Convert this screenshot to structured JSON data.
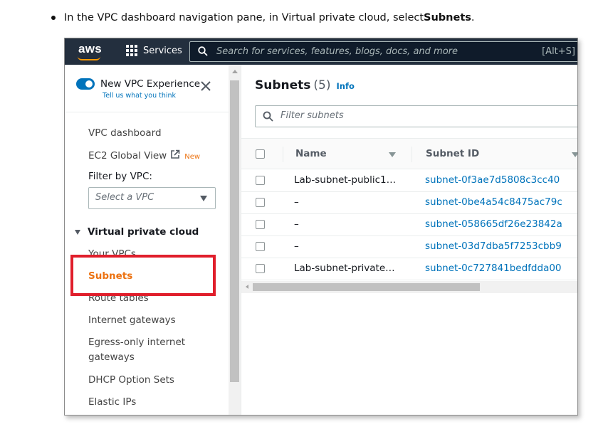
{
  "instruction": {
    "prefix": "In the VPC dashboard navigation pane, in Virtual private cloud, select ",
    "emphasis": "Subnets",
    "suffix": "."
  },
  "topbar": {
    "logo": "aws",
    "services_label": "Services",
    "search_placeholder": "Search for services, features, blogs, docs, and more",
    "search_shortcut": "[Alt+S]"
  },
  "sidebar": {
    "new_experience_label": "New VPC Experience",
    "new_experience_link": "Tell us what you think",
    "toggle_on": true,
    "items": {
      "vpc_dashboard": "VPC dashboard",
      "ec2_global_view": "EC2 Global View",
      "new_badge": "New",
      "filter_by_vpc": "Filter by VPC:",
      "select_vpc_placeholder": "Select a VPC",
      "section_title": "Virtual private cloud",
      "your_vpcs": "Your VPCs",
      "subnets": "Subnets",
      "route_tables": "Route tables",
      "internet_gateways": "Internet gateways",
      "egress_line1": "Egress-only internet",
      "egress_line2": "gateways",
      "dhcp_option_sets": "DHCP Option Sets",
      "elastic_ips": "Elastic IPs"
    }
  },
  "main": {
    "title": "Subnets",
    "count": "(5)",
    "info": "Info",
    "filter_placeholder": "Filter subnets",
    "columns": {
      "name": "Name",
      "subnet_id": "Subnet ID"
    },
    "rows": [
      {
        "name": "Lab-subnet-public1…",
        "subnet_id": "subnet-0f3ae7d5808c3cc40"
      },
      {
        "name": "–",
        "subnet_id": "subnet-0be4a54c8475ac79c"
      },
      {
        "name": "–",
        "subnet_id": "subnet-058665df26e23842a"
      },
      {
        "name": "–",
        "subnet_id": "subnet-03d7dba5f7253cbb9"
      },
      {
        "name": "Lab-subnet-private…",
        "subnet_id": "subnet-0c727841bedfdda00"
      }
    ]
  },
  "colors": {
    "topbar": "#232f3e",
    "accent_orange": "#ec7211",
    "link_blue": "#0073bb",
    "highlight_red": "#e01e2b"
  }
}
